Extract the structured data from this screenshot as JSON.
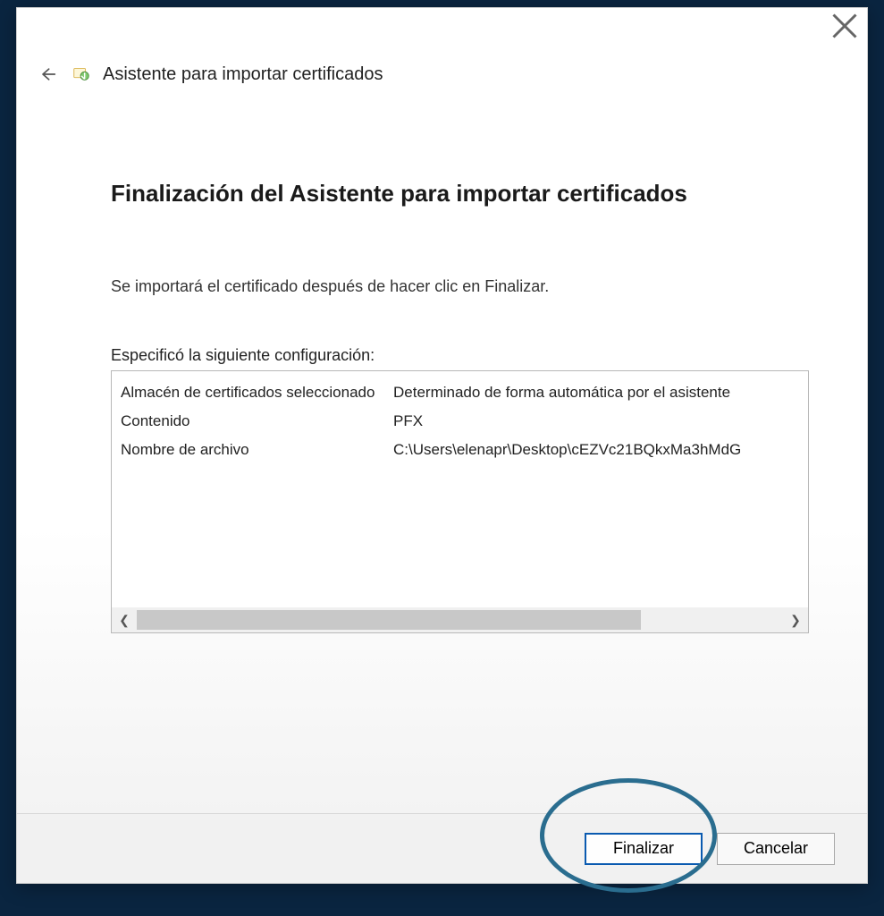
{
  "header": {
    "wizard_title": "Asistente para importar certificados"
  },
  "page": {
    "heading": "Finalización del Asistente para importar certificados",
    "intro": "Se importará el certificado después de hacer clic en Finalizar.",
    "config_label": "Especificó la siguiente configuración:",
    "rows": [
      {
        "key": "Almacén de certificados seleccionado",
        "value": "Determinado de forma automática por el asistente"
      },
      {
        "key": "Contenido",
        "value": "PFX"
      },
      {
        "key": "Nombre de archivo",
        "value": "C:\\Users\\elenapr\\Desktop\\cEZVc21BQkxMa3hMdG"
      }
    ]
  },
  "footer": {
    "finish_label": "Finalizar",
    "cancel_label": "Cancelar"
  }
}
